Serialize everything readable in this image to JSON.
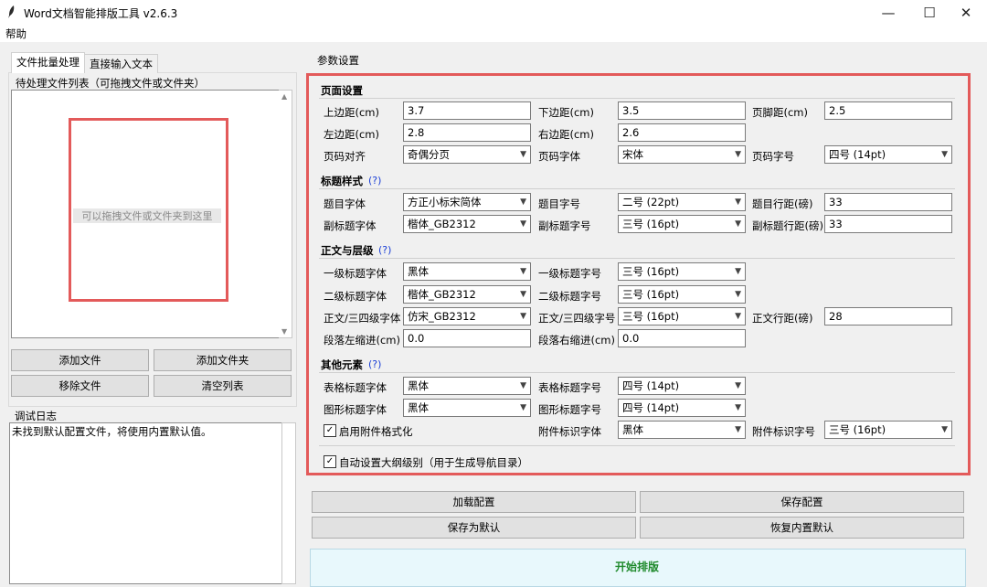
{
  "window": {
    "title": "Word文档智能排版工具 v2.6.3",
    "controls": [
      "—",
      "☐",
      "✕"
    ]
  },
  "menu": {
    "help": "帮助"
  },
  "tabs": {
    "batch": "文件批量处理",
    "direct": "直接输入文本"
  },
  "left": {
    "pending_label": "待处理文件列表（可拖拽文件或文件夹）",
    "drop_hint": "可以拖拽文件或文件夹到这里",
    "buttons": {
      "add_file": "添加文件",
      "add_folder": "添加文件夹",
      "remove": "移除文件",
      "clear": "清空列表"
    },
    "log_label": "调试日志",
    "log_text": "未找到默认配置文件，将使用内置默认值。"
  },
  "params": {
    "label": "参数设置",
    "page": {
      "title": "页面设置",
      "top_margin": {
        "label": "上边距(cm)",
        "value": "3.7"
      },
      "bottom_margin": {
        "label": "下边距(cm)",
        "value": "3.5"
      },
      "footer_margin": {
        "label": "页脚距(cm)",
        "value": "2.5"
      },
      "left_margin": {
        "label": "左边距(cm)",
        "value": "2.8"
      },
      "right_margin": {
        "label": "右边距(cm)",
        "value": "2.6"
      },
      "page_num_align": {
        "label": "页码对齐",
        "value": "奇偶分页"
      },
      "page_num_font": {
        "label": "页码字体",
        "value": "宋体"
      },
      "page_num_size": {
        "label": "页码字号",
        "value": "四号 (14pt)"
      }
    },
    "title_style": {
      "title": "标题样式",
      "q": "(?)",
      "title_font": {
        "label": "题目字体",
        "value": "方正小标宋简体"
      },
      "title_size": {
        "label": "题目字号",
        "value": "二号 (22pt)"
      },
      "title_spacing": {
        "label": "题目行距(磅)",
        "value": "33"
      },
      "sub_font": {
        "label": "副标题字体",
        "value": "楷体_GB2312"
      },
      "sub_size": {
        "label": "副标题字号",
        "value": "三号 (16pt)"
      },
      "sub_spacing": {
        "label": "副标题行距(磅)",
        "value": "33"
      }
    },
    "body": {
      "title": "正文与层级",
      "q": "(?)",
      "h1_font": {
        "label": "一级标题字体",
        "value": "黑体"
      },
      "h1_size": {
        "label": "一级标题字号",
        "value": "三号 (16pt)"
      },
      "h2_font": {
        "label": "二级标题字体",
        "value": "楷体_GB2312"
      },
      "h2_size": {
        "label": "二级标题字号",
        "value": "三号 (16pt)"
      },
      "h3_font": {
        "label": "正文/三四级字体",
        "value": "仿宋_GB2312"
      },
      "h3_size": {
        "label": "正文/三四级字号",
        "value": "三号 (16pt)"
      },
      "body_spacing": {
        "label": "正文行距(磅)",
        "value": "28"
      },
      "left_indent": {
        "label": "段落左缩进(cm)",
        "value": "0.0"
      },
      "right_indent": {
        "label": "段落右缩进(cm)",
        "value": "0.0"
      }
    },
    "other": {
      "title": "其他元素",
      "q": "(?)",
      "table_font": {
        "label": "表格标题字体",
        "value": "黑体"
      },
      "table_size": {
        "label": "表格标题字号",
        "value": "四号 (14pt)"
      },
      "figure_font": {
        "label": "图形标题字体",
        "value": "黑体"
      },
      "figure_size": {
        "label": "图形标题字号",
        "value": "四号 (14pt)"
      },
      "attach_enable": {
        "label": "启用附件格式化",
        "checked": true
      },
      "attach_font": {
        "label": "附件标识字体",
        "value": "黑体"
      },
      "attach_size": {
        "label": "附件标识字号",
        "value": "三号 (16pt)"
      }
    },
    "outline": {
      "label": "自动设置大纲级别（用于生成导航目录）",
      "checked": true
    }
  },
  "actions": {
    "load": "加载配置",
    "save": "保存配置",
    "save_default": "保存为默认",
    "restore": "恢复内置默认",
    "start": "开始排版"
  }
}
